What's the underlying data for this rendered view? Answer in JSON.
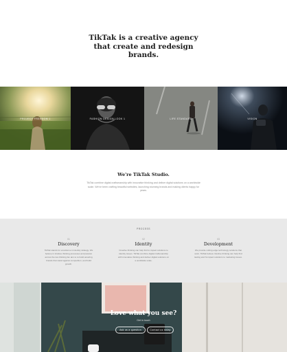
{
  "hero": {
    "title_lines": [
      "TikTak is a creative agency",
      "that create and redesign",
      "brands."
    ]
  },
  "gallery": {
    "tiles": [
      {
        "caption": "PROJECT FREEDOM 1"
      },
      {
        "caption": "FASHION DESIGN LOOK 1"
      },
      {
        "caption": "LIFE STANDARD"
      },
      {
        "caption": "VISION"
      }
    ]
  },
  "studio": {
    "title": "We're TikTak Studio.",
    "body": "TikTak combine digital craftsmanship with innovative thinking and deliver digital solutions on a worldwide scale. We've been crafting beautiful websites, launching stunning brands and making clients happy for years."
  },
  "process": {
    "label": "PROCESS",
    "columns": [
      {
        "num": "01",
        "title": "Discovery",
        "text": "TikTak stands for excellence in identity strategy. We believe in intuitive thinking processes and passion across the two thinking fan aim to to build amazing brands that stand against competition, and build growth."
      },
      {
        "num": "02",
        "title": "Identity",
        "text": "Creative thinking can help find to impact solutions to identity issues. TikTak combine digital craftsmanship with innovative thinking and deliver digital solutions on a worldwide scale."
      },
      {
        "num": "03",
        "title": "Development",
        "text": "We provide cutting edge technology solutions that work. TikTak believe Intuitive thinking can help find lasting and hi-impact solutions to marketing issues."
      }
    ]
  },
  "cta": {
    "title": "Love what you see?",
    "subtitle": "Get in touch",
    "primary_button": "Ask us a question",
    "secondary_button": "Contact us today"
  },
  "colors": {
    "process_bg": "#e9e9e9",
    "text_dark": "#222222",
    "cta_bg": "#2d3b3c"
  }
}
